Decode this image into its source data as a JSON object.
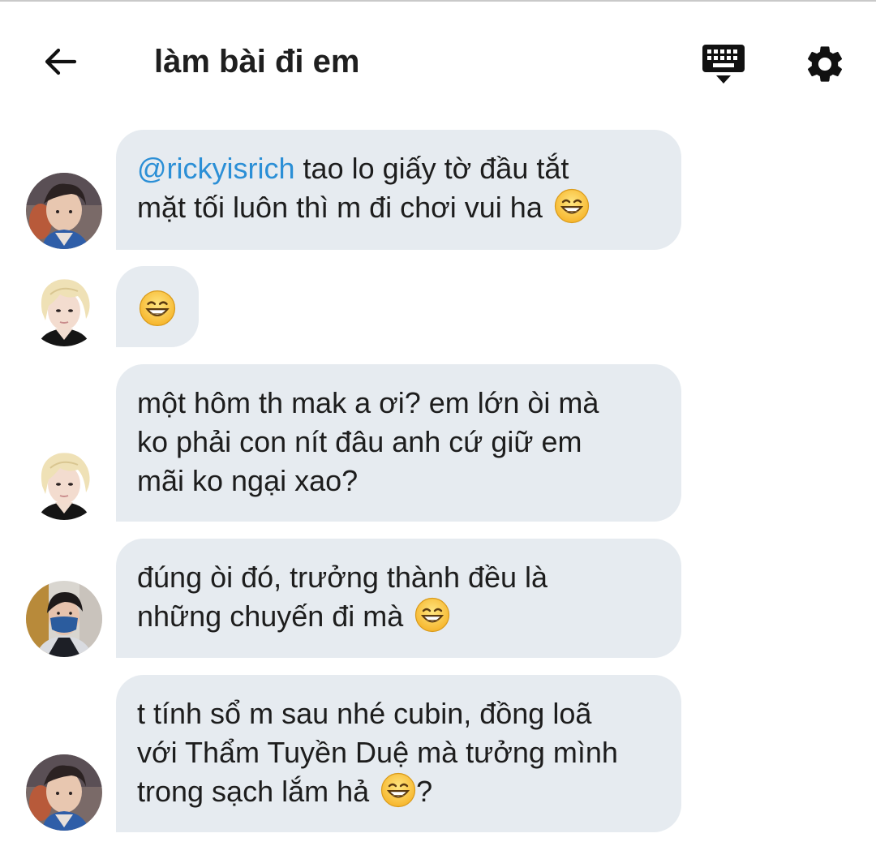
{
  "header": {
    "title": "làm bài đi em",
    "back_icon": "arrow-left-icon",
    "keyboard_icon": "keyboard-icon",
    "settings_icon": "gear-icon"
  },
  "colors": {
    "bubble_bg": "#e6ebf0",
    "mention": "#2b8fd6",
    "text": "#1d1d1d"
  },
  "messages": [
    {
      "avatar": "avatar-user-1",
      "mention": "@rickyisrich",
      "text_line1_rest": " tao lo giấy tờ đầu tắt",
      "text_line2": "mặt tối luôn thì m đi chơi vui ha",
      "emoji": "grinning-face-icon"
    },
    {
      "avatar": "avatar-user-2",
      "emoji": "grinning-face-icon"
    },
    {
      "avatar": "avatar-user-2",
      "text_line1": "một hôm th mak a ơi? em lớn òi mà",
      "text_line2": "ko phải con nít đâu anh cứ giữ em",
      "text_line3": "mãi ko ngại xao?"
    },
    {
      "avatar": "avatar-user-3",
      "text_line1": "đúng òi đó, trưởng thành đều là",
      "text_line2": "những chuyến đi mà",
      "emoji": "grinning-face-icon"
    },
    {
      "avatar": "avatar-user-1",
      "text_line1": "t tính sổ m sau nhé cubin, đồng loã",
      "text_line2": "với Thẩm Tuyền Duệ mà tưởng mình",
      "text_line3": "trong sạch lắm hả",
      "text_line3_after_emoji": "?",
      "emoji": "grinning-face-icon"
    }
  ]
}
